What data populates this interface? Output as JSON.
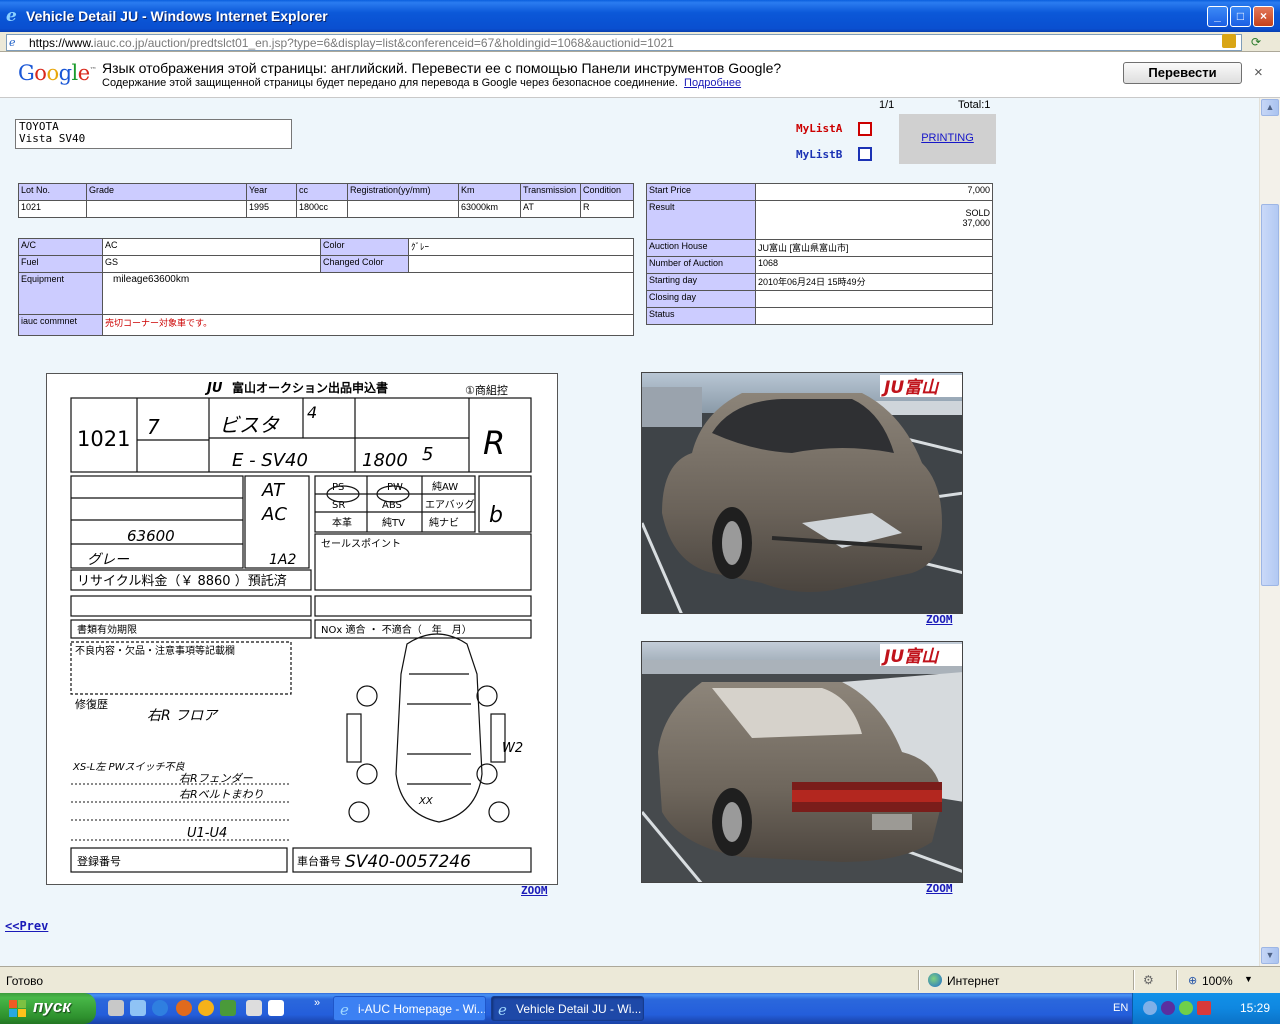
{
  "window": {
    "title": "Vehicle Detail JU - Windows Internet Explorer",
    "url_base": "https://www.",
    "url_path": "iauc.co.jp/auction/predtslct01_en.jsp?type=6&display=list&conferenceid=67&holdingid=1068&auctionid=1021",
    "icons": {
      "browser": "ie-icon",
      "lock": "lock-icon",
      "refresh": "refresh-icon"
    }
  },
  "translate_bar": {
    "logo": "Google",
    "message": "Язык отображения этой страницы: английский. Перевести ее с помощью Панели инструментов Google?",
    "sub": "Содержание этой защищенной страницы будет передано для перевода в Google через безопасное соединение.",
    "more_link": "Подробнее",
    "button": "Перевести",
    "close": "×"
  },
  "header": {
    "page": "1/1",
    "total": "Total:1",
    "make": "TOYOTA",
    "model": "Vista SV40",
    "mylist_a": "MyListA",
    "mylist_b": "MyListB",
    "printing": "PRINTING"
  },
  "lot_table": {
    "headers": [
      "Lot No.",
      "Grade",
      "Year",
      "cc",
      "Registration(yy/mm)",
      "Km",
      "Transmission",
      "Condition"
    ],
    "row": [
      "1021",
      "",
      "1995",
      "1800cc",
      "",
      "63000km",
      "AT",
      "R"
    ]
  },
  "equip_table": {
    "ac_label": "A/C",
    "ac_value": "AC",
    "color_label": "Color",
    "color_value": "ｸﾞﾚｰ",
    "fuel_label": "Fuel",
    "fuel_value": "GS",
    "changed_color_label": "Changed Color",
    "changed_color_value": "",
    "equipment_label": "Equipment",
    "equipment_value": "mileage63600km",
    "comment_label": "iauc commnet",
    "comment_value": "売切コーナー対象車です。"
  },
  "price_table": {
    "start_price_label": "Start Price",
    "start_price": "7,000",
    "result_label": "Result",
    "result_status": "SOLD",
    "result_price": "37,000",
    "auction_house_label": "Auction House",
    "auction_house": "JU富山 [富山県富山市]",
    "number_label": "Number of Auction",
    "number": "1068",
    "starting_day_label": "Starting day",
    "starting_day": "2010年06月24日 15時49分",
    "closing_day_label": "Closing day",
    "closing_day": "",
    "status_label": "Status",
    "status": ""
  },
  "sheet": {
    "title": "富山オークション出品申込書",
    "badge": "①商組控",
    "lot_no": "1021",
    "name_handwritten": "ビスタ",
    "model_code": "E - SV40",
    "cc": "1800",
    "grade_mark": "R",
    "shift": "AT",
    "ac": "AC",
    "color": "グレー",
    "color_no": "1A2",
    "recycle": "リサイクル料金（￥ 8860 ）預託済",
    "chassis_label": "車台番号",
    "chassis": "SV40-0057246",
    "reg_label": "登録番号",
    "sales_point": "セールスポイント",
    "nox": "NOx 適合 ・ 不適合（　年　月）",
    "deadline": "書類有効期限",
    "defects": "不良内容・欠品・注意事項等記載欄",
    "repair": "修復歴",
    "repair_note": "右R フロア",
    "note1": "右Rフェンダー",
    "note2": "右Rベルトまわり",
    "note3": "XS-L左 PWスイッチ不良",
    "note4": "U1-U4",
    "w2": "W2",
    "xx": "XX",
    "logo": "JU",
    "equip_labels": [
      "PS",
      "PW",
      "純AW",
      "SR",
      "ABS",
      "エアバッグ",
      "本革",
      "純TV",
      "純ナビ"
    ]
  },
  "photos": {
    "logo": "JU富山",
    "zoom": "ZOOM"
  },
  "nav": {
    "prev": "<<Prev"
  },
  "status_bar": {
    "text": "Готово",
    "zone": "Интернет",
    "zoom": "100%"
  },
  "taskbar": {
    "start": "пуск",
    "task1": "i-AUC Homepage - Wi...",
    "task2": "Vehicle Detail JU - Wi...",
    "lang": "EN",
    "clock": "15:29"
  },
  "colors": {
    "header_cell": "#ccccff",
    "content_bg": "#eef6fb",
    "link": "#1a1ab8",
    "mylist_a": "#cc0000",
    "mylist_b": "#1b32b4"
  }
}
